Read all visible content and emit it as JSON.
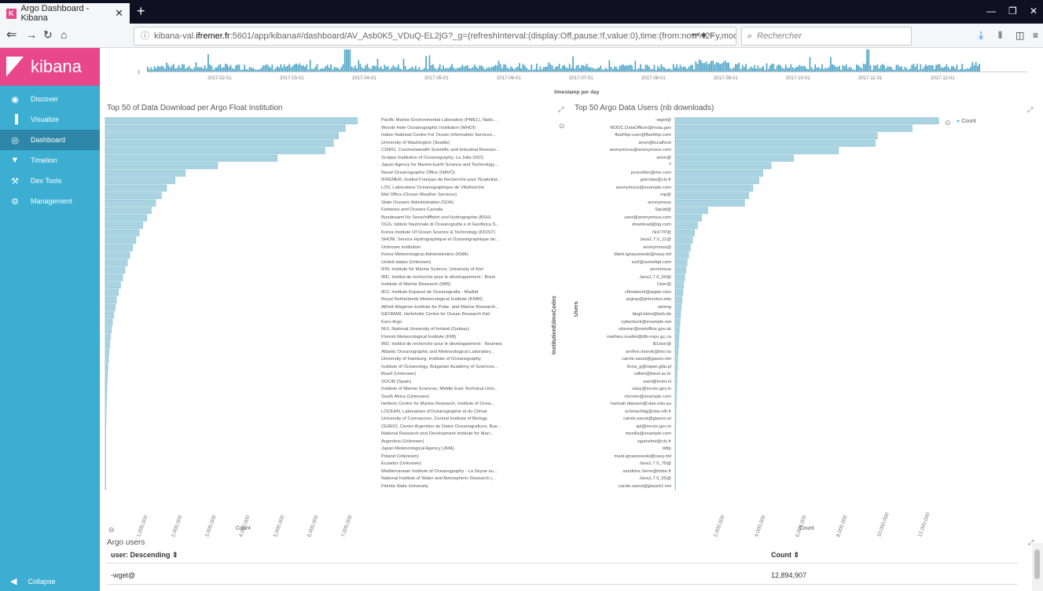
{
  "browser": {
    "tab_title": "Argo Dashboard - Kibana",
    "url_info": "ⓘ",
    "url_prefix": "kibana-val.",
    "url_host": "ifremer.fr",
    "url_rest": ":5601/app/kibana#/dashboard/AV_Asb0K5_VDuQ-EL2jG?_g=(refreshInterval:(display:Off,pause:!f,value:0),time:(from:now%2Fy,mode:qu",
    "url_actions": "•••  ◆  ☆",
    "search_placeholder": "Rechercher",
    "search_icon": "search-icon"
  },
  "sidebar": {
    "brand": "kibana",
    "items": [
      {
        "label": "Discover",
        "icon": "compass-icon",
        "glyph": "◉",
        "active": false
      },
      {
        "label": "Visualize",
        "icon": "bar-chart-icon",
        "glyph": "▐",
        "active": false
      },
      {
        "label": "Dashboard",
        "icon": "dashboard-icon",
        "glyph": "◎",
        "active": true
      },
      {
        "label": "Timelion",
        "icon": "shield-icon",
        "glyph": "▼",
        "active": false
      },
      {
        "label": "Dev Tools",
        "icon": "wrench-icon",
        "glyph": "⚒",
        "active": false
      },
      {
        "label": "Management",
        "icon": "gear-icon",
        "glyph": "⚙",
        "active": false
      }
    ],
    "collapse_label": "Collapse"
  },
  "timeline": {
    "xlabel": "timestamp per day",
    "y_tick": "0",
    "ticks": [
      "2017-02-01",
      "2017-03-01",
      "2017-04-01",
      "2017-05-01",
      "2017-06-01",
      "2017-07-01",
      "2017-08-01",
      "2017-09-01",
      "2017-10-01",
      "2017-11-01",
      "2017-12-01"
    ]
  },
  "left_panel": {
    "title": "Top 50 of Data Download per Argo Float Institution",
    "ylabel": "InstitutionEdmoCodes",
    "xlabel": "Count",
    "x_ticks": [
      "1,000,000",
      "2,000,000",
      "3,000,000",
      "4,000,000",
      "5,000,000",
      "6,000,000",
      "7,000,000"
    ]
  },
  "right_panel": {
    "title": "Top 50 Argo Data Users (nb downloads)",
    "ylabel": "Users",
    "xlabel": "Count",
    "legend": "Count",
    "x_ticks": [
      "2,000,000",
      "4,000,000",
      "6,000,000",
      "8,000,000",
      "10,000,000",
      "12,000,000"
    ]
  },
  "table": {
    "title": "Argo users",
    "col1": "user: Descending ⇕",
    "col2": "Count ⇕",
    "rows": [
      {
        "user": "-wget@",
        "count": "12,894,907"
      }
    ]
  },
  "chart_data": [
    {
      "type": "bar",
      "title": "Top 50 of Data Download per Argo Float Institution",
      "xlabel": "Count",
      "ylabel": "InstitutionEdmoCodes",
      "orientation": "horizontal",
      "xlim": [
        0,
        7500000
      ],
      "categories": [
        "Pacific Marine Environmental Laboratory (PMEL), Natio...",
        "Woods Hole Oceanographic Institution (WHOI)",
        "Indian National Centre For Ocean Information Services...",
        "University of Washington (Seattle)",
        "CSIRO, Commonwealth Scientific and Industrial Researc...",
        "Scripps Institution of Oceanography, La Jolla (SIO)",
        "Japan Agency for Marine-Earth Science and Technology...",
        "Naval Oceanographic Office (NAVO)",
        "IFREMER, Institut Français de Recherche pour l'Exploitat...",
        "LOV, Laboratoire Océanographique de Villefranche",
        "Met Office (Ocean Weather Services)",
        "State Oceanic Administration (SOA)",
        "Fisheries and Oceans Canada",
        "Bundesamt für Seeschifffahrt und Hydrographie (BSH)",
        "OGS, Istituto Nazionale di Oceanografia e di Geofisica S...",
        "Korea Institute Of Ocean Science & Technology (KIOST)",
        "SHOM, Service Hydrographique et Océanographique de...",
        "Unknown institution",
        "Korea Meteorological Administration (KMA)",
        "United states (Unknown)",
        "IFM, Institute for Marine Science, University of Kiel",
        "IRD, Institut de recherche pour le développement - Brest",
        "Institute of Marine Research (IMR)",
        "IEO, Instituto Espanol de Oceanografia - Madrid",
        "Royal Netherlands Meteorological Institute (KNMI)",
        "Alfred-Wegener-Institute for Polar- and Marine Research...",
        "GEOMAR, Helmholtz Centre for Ocean Research Kiel",
        "Euro-Argo",
        "NUI, National University of Ireland (Galway)",
        "Finnish Meteorological Institute (FMI)",
        "IRD, Institut de recherche pour le développement - Noumea",
        "Atlantic Oceanographic and Meteorological Laboratory...",
        "University of Hamburg, Institute of Oceanography",
        "Institute of Oceanology, Bulgarian Academy of Sciences...",
        "Brazil (Unknown)",
        "SOCIB (Spain)",
        "Institute of Marine Sciences, Middle East Technical Univ...",
        "South Africa (Unknown)",
        "Hellenic Centre for Marine Research, Institute of Ocea...",
        "LOCEAN, Laboratoire d'Océanographie et du Climat",
        "University of Concepcion, Central Institute of Biology",
        "CEADO, Centro Argentino de Datos Oceanograficos, Bue...",
        "National Research and Development Institute for Mari...",
        "Argentina (Unknown)",
        "Japan Meteorological Agency (JMA)",
        "Poland (Unknown)",
        "Ecuador (Unknown)",
        "Mediterranean Institute of Oceanography - La Seyne su...",
        "National Institute of Water and Atmospheric Research (...",
        "Florida State University"
      ],
      "values": [
        7400000,
        7050000,
        6850000,
        6700000,
        6450000,
        5050000,
        3300000,
        2350000,
        2050000,
        1800000,
        1650000,
        1480000,
        1350000,
        1220000,
        1100000,
        1000000,
        900000,
        800000,
        720000,
        650000,
        580000,
        510000,
        450000,
        390000,
        330000,
        290000,
        250000,
        210000,
        180000,
        150000,
        130000,
        110000,
        95000,
        80000,
        68000,
        57000,
        48000,
        40000,
        33000,
        27000,
        22000,
        18000,
        14000,
        11000,
        9000,
        7000,
        5000,
        4000,
        3000,
        2000
      ]
    },
    {
      "type": "bar",
      "title": "Top 50 Argo Data Users (nb downloads)",
      "xlabel": "Count",
      "ylabel": "Users",
      "orientation": "horizontal",
      "xlim": [
        0,
        13000000
      ],
      "legend": [
        "Count"
      ],
      "categories": [
        "-wget@",
        "NODC.DataOfficer@noaa.gov",
        "flashfxp-user@flashfxp.com",
        "anon@localhost",
        "anonymous@anonymous.com",
        "anon@",
        "?",
        "pcornillon@me.com",
        "gnicolas@cls.fr",
        "anonymous@example.com",
        "mp@",
        "anonymous",
        "Squid@",
        "user@anonymous.com",
        "download@qq.com",
        "NcFTP@",
        "Java1.7.0_11@",
        "anonymous@",
        "Mark.Ignaszewski@navy.mil",
        "surf@somefqd.com",
        "anonmous",
        "Java1.7.0_60@",
        "User@",
        "cftnetwork@apple.com",
        "argray@princeton.edu",
        "aweng",
        "birgit.klein@bsh.de",
        "cyberduck@example.net",
        "obsmar@metoffice.gov.uk",
        "mathieu.ouellet@dfo-mpo.gc.ca",
        "IEUser@",
        "arnfinn.morvik@imr.no",
        "carole.saout@gazeo.net",
        "ilona_g@iopan.gda.pl",
        "sdkim@kiost.ac.kr",
        "swiri@knmi.nl",
        "uday@incois.gov.in",
        "chrome@example.com",
        "hannah.dawson@utas.edu.au",
        "schmechtig@obs-vlfr.fr",
        "carole.saout@glazeo.et",
        "sjd@incois.gov.in",
        "mozilla@example.com",
        "sguinehut@cls.fr",
        "ibftp",
        "mark.ignaszewski@navy.mil",
        "Java1.7.0_75@",
        "sandrine.Serre@imbe.fr",
        "Java1.7.0_55@",
        "carole.saout@glazeo1.net"
      ],
      "values": [
        12894907,
        11600000,
        9900000,
        9800000,
        8000000,
        5800000,
        4700000,
        4300000,
        4100000,
        3800000,
        3600000,
        3400000,
        1600000,
        1300000,
        1100000,
        950000,
        850000,
        750000,
        660000,
        590000,
        530000,
        470000,
        420000,
        380000,
        340000,
        300000,
        270000,
        240000,
        210000,
        190000,
        170000,
        150000,
        130000,
        115000,
        100000,
        88000,
        76000,
        66000,
        57000,
        49000,
        42000,
        36000,
        30000,
        25000,
        21000,
        17000,
        14000,
        11000,
        8000,
        6000
      ]
    },
    {
      "type": "bar",
      "title": "",
      "xlabel": "timestamp per day",
      "ylabel": "",
      "note_values": "daily download counts, relative",
      "categories": [],
      "values": []
    }
  ]
}
